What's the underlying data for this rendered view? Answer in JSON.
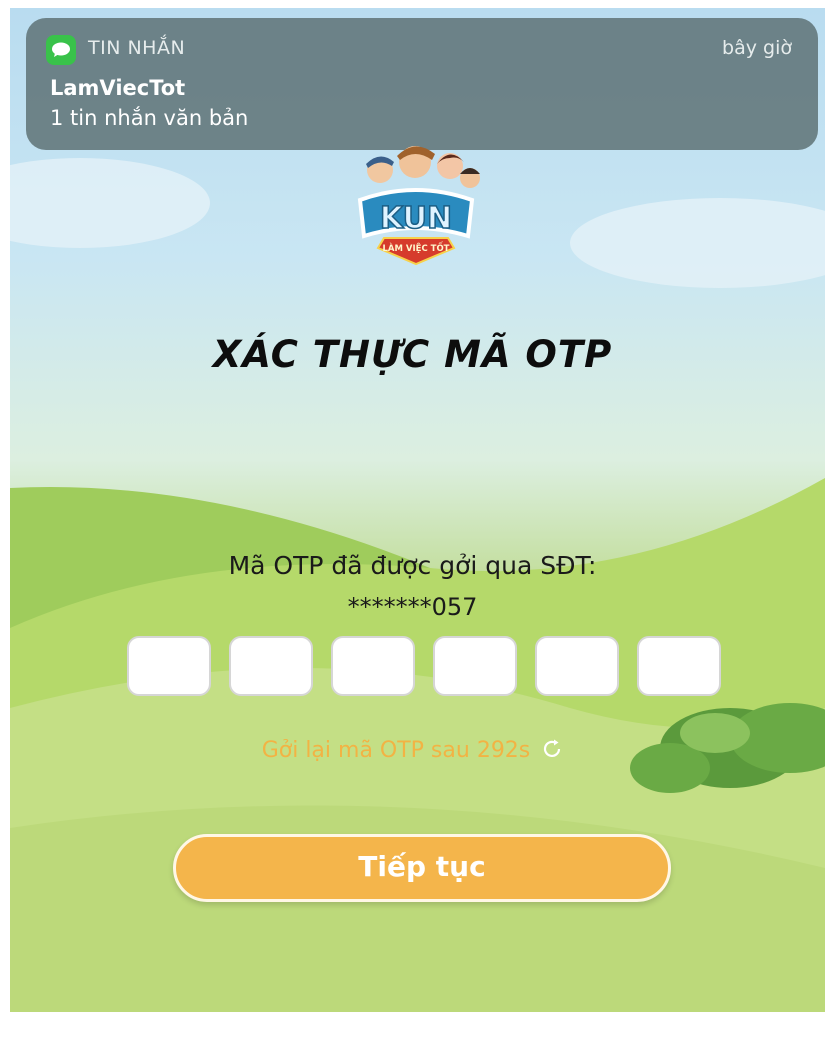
{
  "notification": {
    "app_name": "TIN NHẮN",
    "time": "bây giờ",
    "sender": "LamViecTot",
    "message": "1 tin nhắn văn bản",
    "icon": "messages-icon"
  },
  "logo": {
    "text_main": "KUN",
    "text_ribbon": "LÀM VIỆC TỐT"
  },
  "page": {
    "title": "XÁC THỰC MÃ OTP",
    "otp_message": "Mã OTP đã được gởi qua SĐT:",
    "phone_masked": "*******057",
    "otp_digits": [
      "",
      "",
      "",
      "",
      "",
      ""
    ],
    "resend_text": "Gởi lại mã OTP sau 292s",
    "continue_label": "Tiếp tục"
  },
  "colors": {
    "accent": "#f4b54b",
    "resend": "#f2b344",
    "notification_bg": "#5a6e70",
    "messages_green": "#39c24a"
  }
}
